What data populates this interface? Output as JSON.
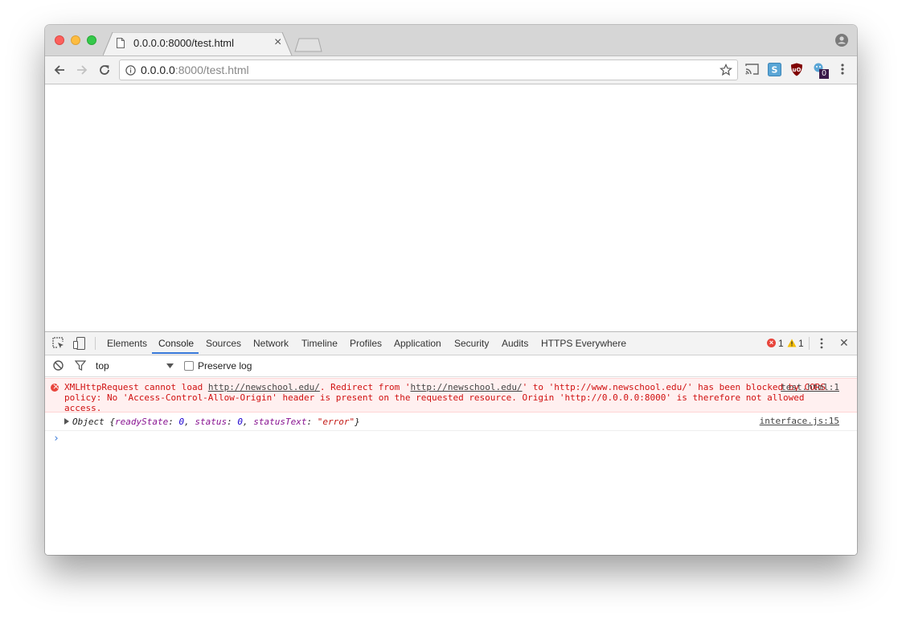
{
  "browser": {
    "tab_title": "0.0.0.0:8000/test.html",
    "tab_close": "×",
    "url_host": "0.0.0.0",
    "url_rest": ":8000/test.html",
    "extension_badge": "0"
  },
  "devtools": {
    "tabs": [
      "Elements",
      "Console",
      "Sources",
      "Network",
      "Timeline",
      "Profiles",
      "Application",
      "Security",
      "Audits",
      "HTTPS Everywhere"
    ],
    "active_tab": "Console",
    "error_count": "1",
    "warning_count": "1",
    "close": "✕",
    "context": "top",
    "preserve_log_label": "Preserve log"
  },
  "console": {
    "error": {
      "part1": "XMLHttpRequest cannot load ",
      "link1": "http://newschool.edu/",
      "part2": ". Redirect from '",
      "link2": "http://newschool.edu/",
      "part3": "' to 'http://www.newschool.edu/' has been blocked by CORS policy: No 'Access-Control-Allow-Origin' header is present on the requested resource. Origin 'http://0.0.0.0:8000' is therefore not allowed access.",
      "source": "test.html:1"
    },
    "object": {
      "prefix": "Object {",
      "k1": "readyState",
      "v1": "0",
      "k2": "status",
      "v2": "0",
      "k3": "statusText",
      "v3": "\"error\"",
      "suffix": "}",
      "source": "interface.js:15"
    },
    "prompt": "›"
  },
  "colors": {
    "error_text": "#d01010",
    "accent": "#3879d9"
  }
}
